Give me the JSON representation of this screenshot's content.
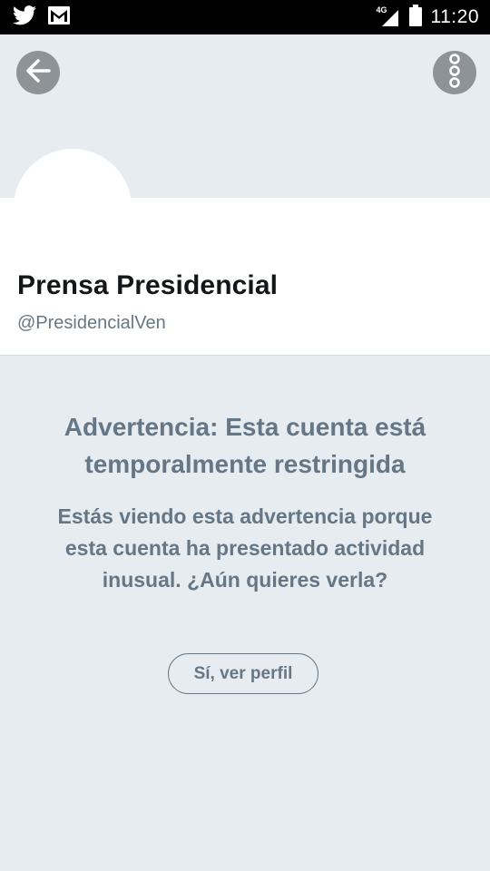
{
  "status_bar": {
    "network_type": "4G",
    "time": "11:20",
    "left_icons": [
      "twitter-bird-icon",
      "gmail-icon"
    ],
    "right_icons": [
      "signal-icon",
      "battery-icon"
    ]
  },
  "header": {
    "back_icon": "arrow-left-icon",
    "more_icon": "more-vertical-icon"
  },
  "profile": {
    "display_name": "Prensa Presidencial",
    "handle": "@PresidencialVen"
  },
  "warning": {
    "title": "Advertencia: Esta cuenta está temporalmente restringida",
    "body": "Estás viendo esta advertencia porque esta cuenta ha presentado actividad inusual. ¿Aún quieres verla?",
    "button_label": "Sí, ver perfil"
  },
  "colors": {
    "background": "#e6ecf0",
    "card": "#ffffff",
    "muted_text": "#657786",
    "name_text": "#14171a",
    "icon_button": "#8e9398",
    "status_bar": "#000000"
  }
}
